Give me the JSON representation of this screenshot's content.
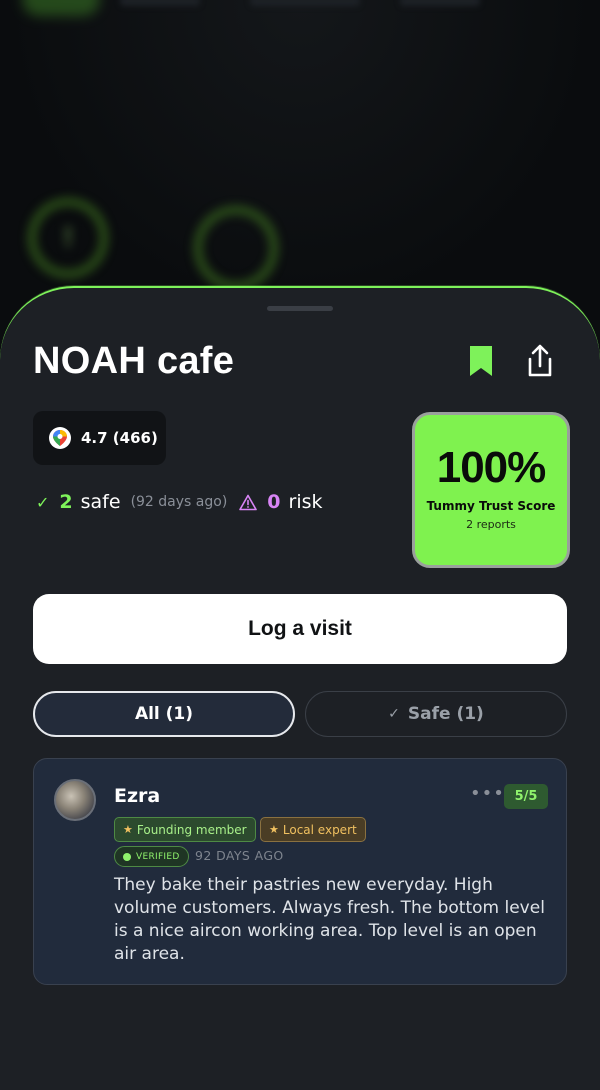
{
  "place": {
    "name": "NOAH cafe",
    "rating": "4.7 (466)"
  },
  "stats": {
    "safe_count": "2",
    "safe_label": "safe",
    "safe_ago": "(92 days ago)",
    "risk_count": "0",
    "risk_label": "risk"
  },
  "score": {
    "value": "100%",
    "label": "Tummy Trust Score",
    "reports": "2 reports"
  },
  "actions": {
    "log_visit": "Log a visit"
  },
  "tabs": {
    "all": "All (1)",
    "safe": "Safe (1)"
  },
  "review": {
    "author": "Ezra",
    "rating": "5/5",
    "badges": [
      "Founding member",
      "Local expert"
    ],
    "verified": "VERIFIED",
    "time": "92 DAYS AGO",
    "text": "They bake their pastries new everyday. High volume customers. Always fresh. The bottom level is a nice aircon working area. Top level is an open air area."
  },
  "colors": {
    "accent": "#7ef25a",
    "risk": "#d884f5",
    "sheet": "#1d2025",
    "card": "#212b3c"
  }
}
